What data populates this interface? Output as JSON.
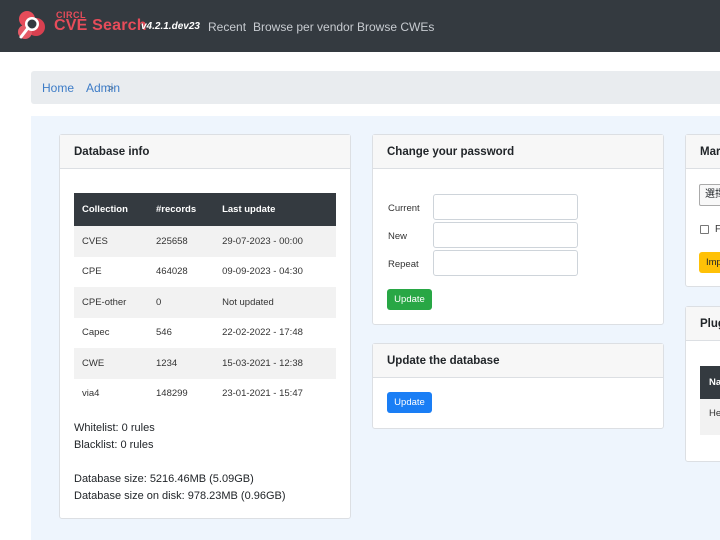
{
  "navbar": {
    "brand_small": "CIRCL",
    "brand_big": "CVE Search",
    "version": "v4.2.1.dev23",
    "links": [
      "Recent",
      "Browse per vendor",
      "Browse CWEs"
    ]
  },
  "breadcrumb": {
    "home": "Home",
    "separator": ">",
    "current": "Admin"
  },
  "database_info": {
    "title": "Database info",
    "columns": [
      "Collection",
      "#records",
      "Last update"
    ],
    "rows": [
      [
        "CVES",
        "225658",
        "29-07-2023 - 00:00"
      ],
      [
        "CPE",
        "464028",
        "09-09-2023 - 04:30"
      ],
      [
        "CPE-other",
        "0",
        "Not updated"
      ],
      [
        "Capec",
        "546",
        "22-02-2022 - 17:48"
      ],
      [
        "CWE",
        "1234",
        "15-03-2021 - 12:38"
      ],
      [
        "via4",
        "148299",
        "23-01-2021 - 15:47"
      ]
    ],
    "whitelist": "Whitelist: 0 rules",
    "blacklist": "Blacklist: 0 rules",
    "db_size": "Database size: 5216.46MB (5.09GB)",
    "db_size_disk": "Database size on disk: 978.23MB (0.96GB)"
  },
  "change_password": {
    "title": "Change your password",
    "current_label": "Current",
    "new_label": "New",
    "repeat_label": "Repeat",
    "update_label": "Update"
  },
  "update_database": {
    "title": "Update the database",
    "update_label": "Update"
  },
  "manage_card": {
    "title": "Mar",
    "select_text": "選擇",
    "checkbox_label": "F",
    "import_button": "Imp"
  },
  "plugins_card": {
    "title": "Plug",
    "th": "Na",
    "td": "He"
  },
  "colors": {
    "navbar_bg": "#343a40",
    "brand": "#e74c5a",
    "link": "#3d7cc7",
    "content_bg": "#eef5fd",
    "btn_green": "#28a745",
    "btn_blue": "#1a7ef5",
    "btn_yellow": "#ffc107"
  }
}
